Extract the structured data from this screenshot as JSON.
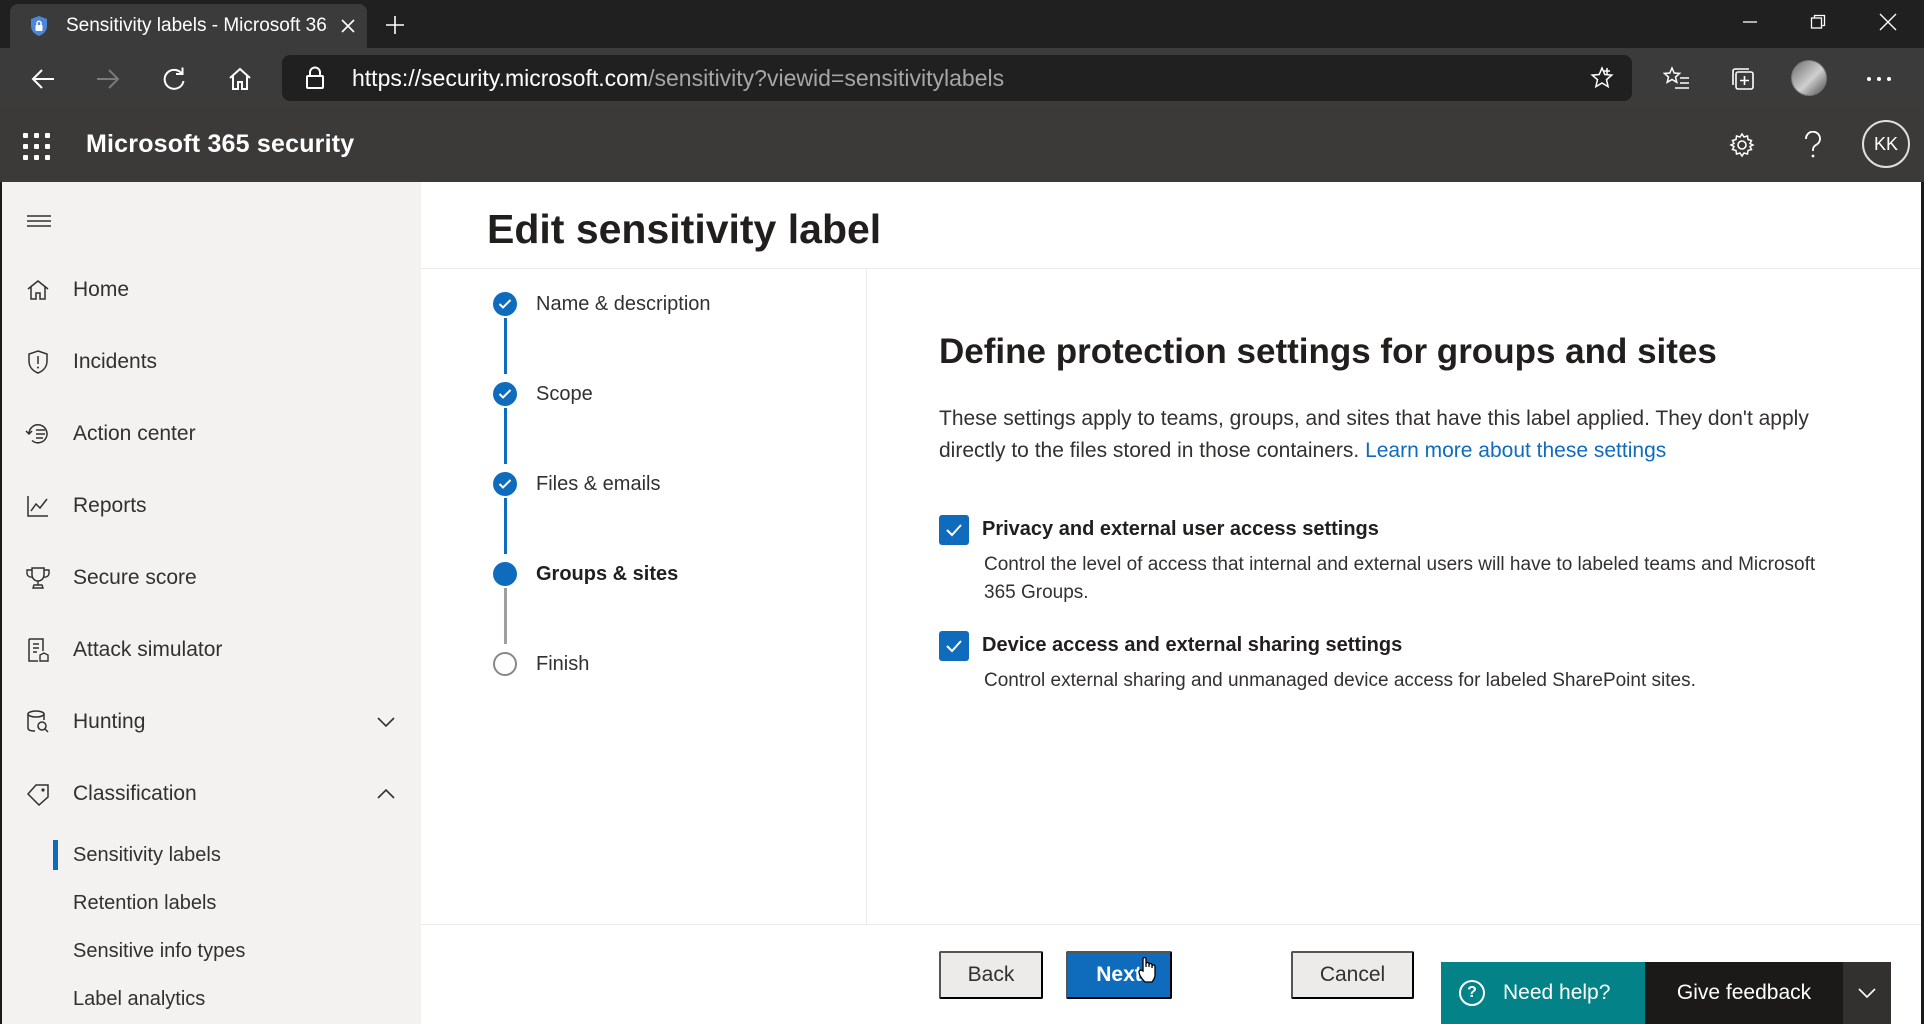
{
  "browser": {
    "tab_title": "Sensitivity labels - Microsoft 365 security",
    "url_host": "https://security.microsoft.com",
    "url_path": "/sensitivity?viewid=sensitivitylabels"
  },
  "app": {
    "name": "Microsoft 365 security",
    "avatar_initials": "KK"
  },
  "nav": {
    "items": [
      {
        "label": "Home",
        "icon": "home-icon"
      },
      {
        "label": "Incidents",
        "icon": "shield-icon"
      },
      {
        "label": "Action center",
        "icon": "history-icon"
      },
      {
        "label": "Reports",
        "icon": "chart-icon"
      },
      {
        "label": "Secure score",
        "icon": "trophy-icon"
      },
      {
        "label": "Attack simulator",
        "icon": "document-list-icon"
      },
      {
        "label": "Hunting",
        "icon": "database-search-icon"
      },
      {
        "label": "Classification",
        "icon": "tag-icon"
      }
    ],
    "subitems": [
      {
        "label": "Sensitivity labels",
        "selected": true
      },
      {
        "label": "Retention labels"
      },
      {
        "label": "Sensitive info types"
      },
      {
        "label": "Label analytics"
      }
    ]
  },
  "page": {
    "title": "Edit sensitivity label"
  },
  "wizard": {
    "steps": [
      {
        "label": "Name & description",
        "state": "done"
      },
      {
        "label": "Scope",
        "state": "done"
      },
      {
        "label": "Files & emails",
        "state": "done"
      },
      {
        "label": "Groups & sites",
        "state": "current"
      },
      {
        "label": "Finish",
        "state": "todo"
      }
    ]
  },
  "content": {
    "heading": "Define protection settings for groups and sites",
    "intro": "These settings apply to teams, groups, and sites that have this label applied. They don't apply directly to the files stored in those containers.",
    "learn_more": "Learn more about these settings",
    "options": [
      {
        "label": "Privacy and external user access settings",
        "description": "Control the level of access that internal and external users will have to labeled teams and Microsoft 365 Groups.",
        "checked": true
      },
      {
        "label": "Device access and external sharing settings",
        "description": "Control external sharing and unmanaged device access for labeled SharePoint sites.",
        "checked": true
      }
    ]
  },
  "footer": {
    "back": "Back",
    "next": "Next",
    "cancel": "Cancel",
    "need_help": "Need help?",
    "give_feedback": "Give feedback"
  },
  "colors": {
    "accent": "#0f6cbd",
    "header": "#3b3a39",
    "help": "#038387"
  }
}
